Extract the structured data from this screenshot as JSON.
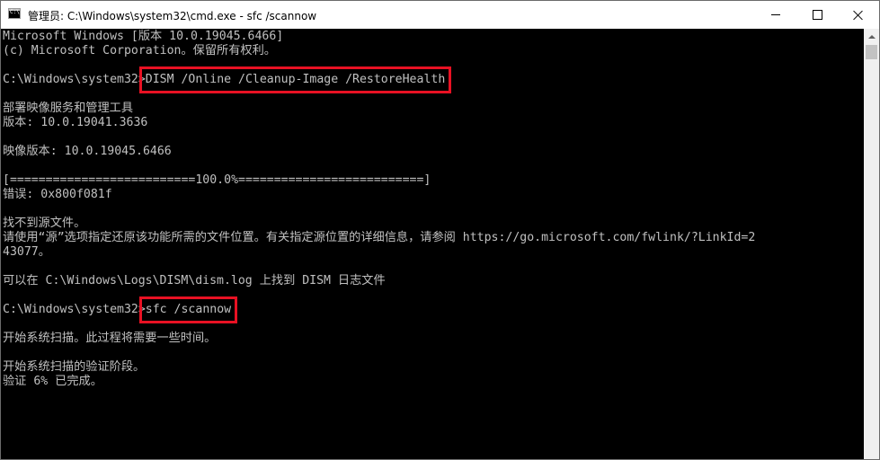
{
  "window": {
    "title": "管理员: C:\\Windows\\system32\\cmd.exe - sfc  /scannow",
    "icon": "cmd-icon",
    "icon_label": "C:\\",
    "controls": {
      "minimize": "minimize-icon",
      "maximize": "maximize-icon",
      "close": "close-icon"
    }
  },
  "console": {
    "lines": [
      "Microsoft Windows [版本 10.0.19045.6466]",
      "(c) Microsoft Corporation。保留所有权利。",
      "",
      "",
      "",
      "部署映像服务和管理工具",
      "版本: 10.0.19041.3636",
      "",
      "映像版本: 10.0.19045.6466",
      "",
      "[==========================100.0%==========================]",
      "错误: 0x800f081f",
      "",
      "找不到源文件。",
      "请使用“源”选项指定还原该功能所需的文件位置。有关指定源位置的详细信息，请参阅 https://go.microsoft.com/fwlink/?LinkId=2",
      "43077。",
      "",
      "可以在 C:\\Windows\\Logs\\DISM\\dism.log 上找到 DISM 日志文件",
      "",
      "",
      "",
      "开始系统扫描。此过程将需要一些时间。",
      "",
      "开始系统扫描的验证阶段。",
      "验证 6% 已完成。"
    ],
    "prompt1": {
      "path": "C:\\Windows\\system32>",
      "command": "DISM /Online /Cleanup-Image /RestoreHealth"
    },
    "prompt2": {
      "path": "C:\\Windows\\system32>",
      "command": "sfc /scannow"
    },
    "highlight_color": "#e81123",
    "text_color": "#c0c0c0",
    "background_color": "#000000"
  }
}
